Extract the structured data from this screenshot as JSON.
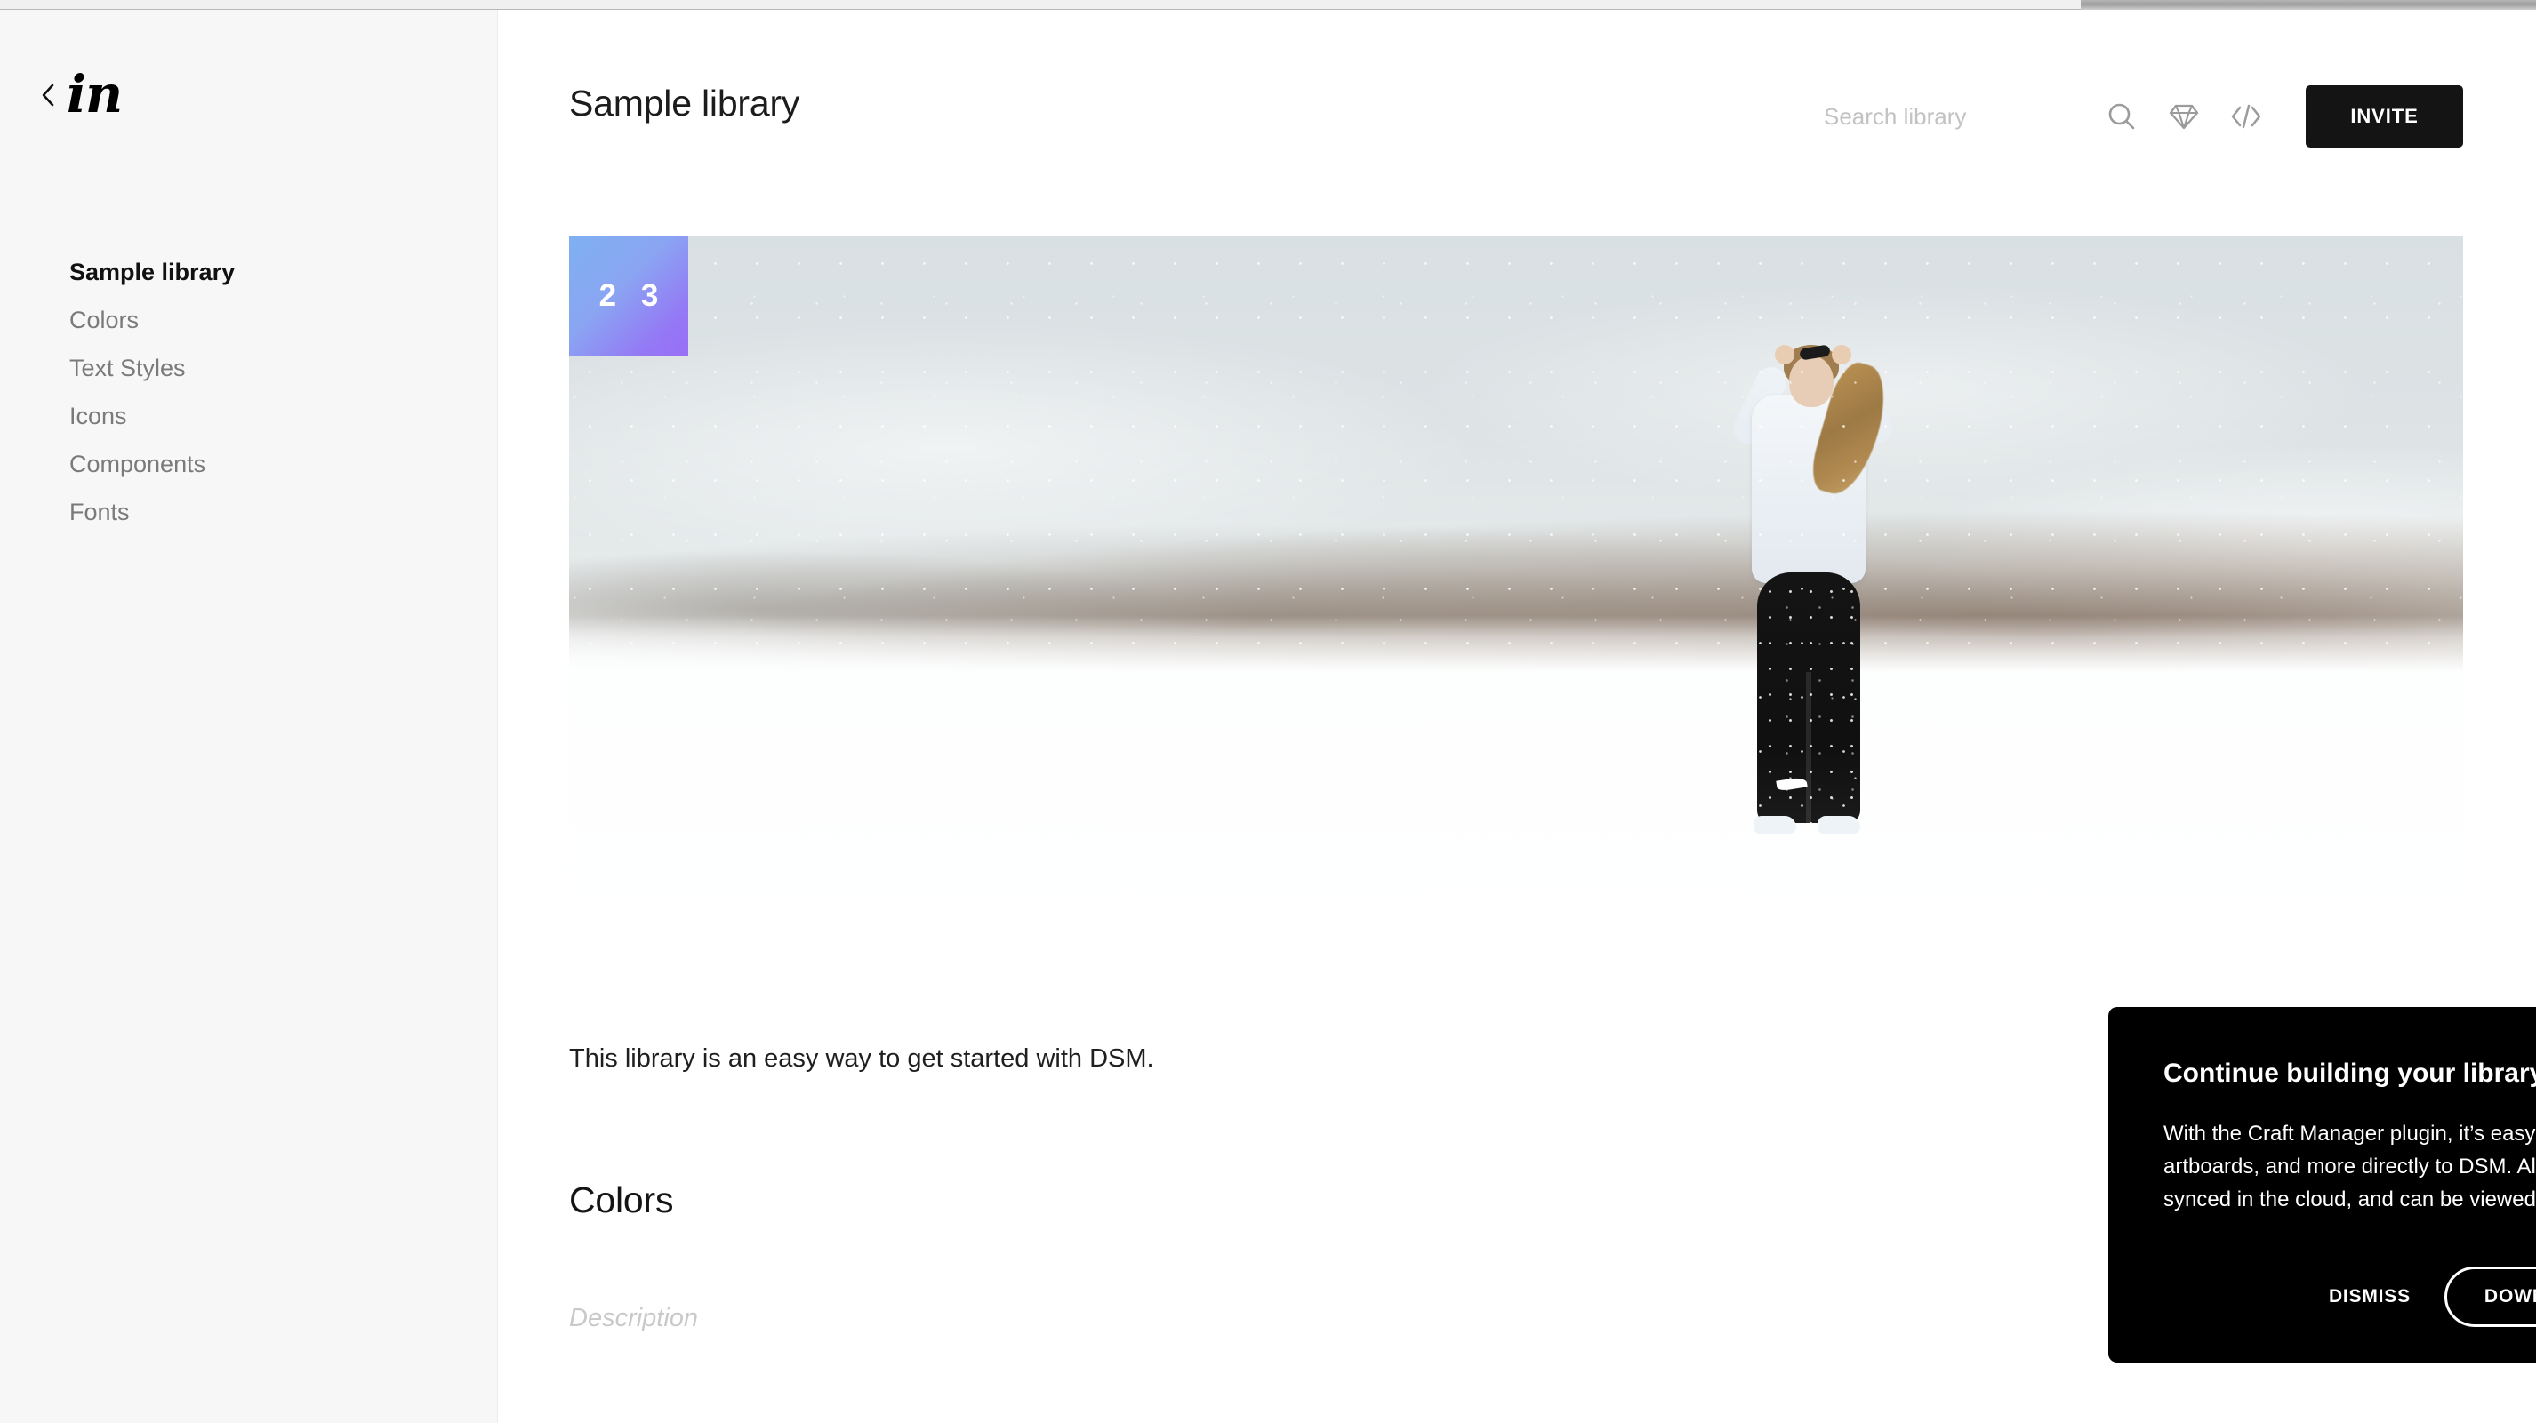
{
  "window": {
    "chrome_strip": ""
  },
  "sidebar": {
    "logo": "in",
    "back_icon": "back-chevron-icon",
    "items": [
      {
        "label": "Sample library",
        "active": true
      },
      {
        "label": "Colors",
        "active": false
      },
      {
        "label": "Text Styles",
        "active": false
      },
      {
        "label": "Icons",
        "active": false
      },
      {
        "label": "Components",
        "active": false
      },
      {
        "label": "Fonts",
        "active": false
      }
    ]
  },
  "header": {
    "title": "Sample library",
    "search": {
      "placeholder": "Search library",
      "value": ""
    },
    "icons": [
      {
        "name": "search-icon"
      },
      {
        "name": "sketch-diamond-icon"
      },
      {
        "name": "code-brackets-icon"
      }
    ],
    "invite_label": "INVITE"
  },
  "hero": {
    "tile_label": "2 3",
    "tile_gradient_start": "#7fb0f2",
    "tile_gradient_end": "#9a6ff6",
    "image_alt": "Woman standing in a snowy field tying her hair"
  },
  "content": {
    "library_description": "This library is an easy way to get started with DSM.",
    "section_heading": "Colors",
    "section_description_placeholder": "Description"
  },
  "promo": {
    "title": "Continue building your library from Sketch",
    "body": "With the Craft Manager plugin, it’s easy to add colors, artboards, and more directly to DSM. All changes are synced in the cloud, and can be viewed here anytime.",
    "dismiss_label": "DISMISS",
    "download_label": "DOWNLOAD THE PLUGIN",
    "background_color": "#000000",
    "text_color": "#ffffff"
  },
  "colors": {
    "accent_dark": "#141414",
    "sidebar_bg": "#f7f7f7",
    "muted_text": "#7a7a7a",
    "icon_gray": "#9b9b9b"
  }
}
